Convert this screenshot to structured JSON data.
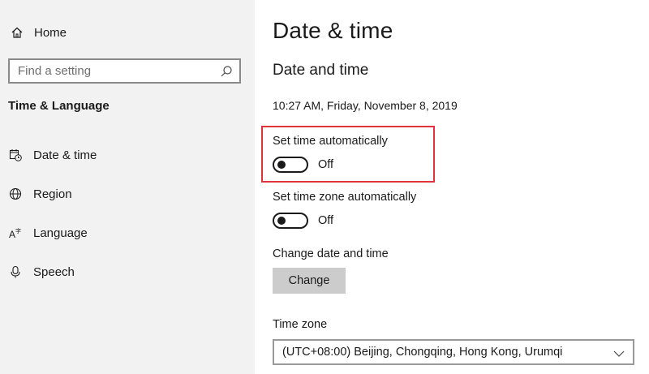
{
  "sidebar": {
    "home_label": "Home",
    "search": {
      "placeholder": "Find a setting",
      "icon": "search-icon"
    },
    "section_title": "Time & Language",
    "items": [
      {
        "label": "Date & time",
        "icon": "calendar-clock-icon"
      },
      {
        "label": "Region",
        "icon": "globe-icon"
      },
      {
        "label": "Language",
        "icon": "language-icon"
      },
      {
        "label": "Speech",
        "icon": "microphone-icon"
      }
    ]
  },
  "main": {
    "page_title": "Date & time",
    "section_title": "Date and time",
    "current_datetime": "10:27 AM, Friday, November 8, 2019",
    "set_time_auto": {
      "label": "Set time automatically",
      "state": "Off"
    },
    "set_timezone_auto": {
      "label": "Set time zone automatically",
      "state": "Off"
    },
    "change_datetime": {
      "label": "Change date and time",
      "button": "Change"
    },
    "time_zone": {
      "label": "Time zone",
      "value": "(UTC+08:00) Beijing, Chongqing, Hong Kong, Urumqi"
    }
  },
  "colors": {
    "highlight": "#e0343a",
    "sidebar_bg": "#f2f2f2",
    "button_bg": "#cccccc"
  }
}
